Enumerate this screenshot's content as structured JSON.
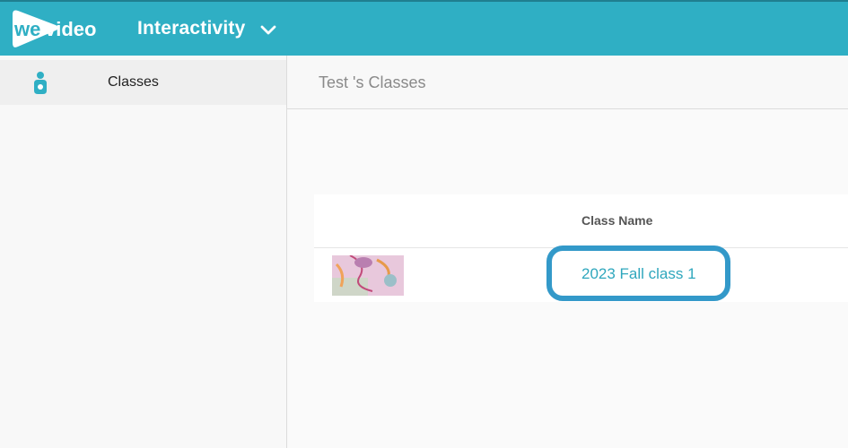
{
  "header": {
    "logo_text": "wevideo",
    "app_title": "Interactivity",
    "app_menu_icon": "chevron-down-icon"
  },
  "sidebar": {
    "items": [
      {
        "label": "Classes",
        "icon": "classes-person-icon",
        "selected": true
      }
    ]
  },
  "page": {
    "title": "Test 's Classes"
  },
  "table": {
    "columns": [
      "",
      "Class Name"
    ],
    "rows": [
      {
        "thumbnail": "class-thumbnail",
        "class_name": "2023 Fall class 1"
      }
    ]
  },
  "colors": {
    "brand": "#2fafc4",
    "link": "#2fa7bd",
    "highlight": "#3399c9"
  }
}
